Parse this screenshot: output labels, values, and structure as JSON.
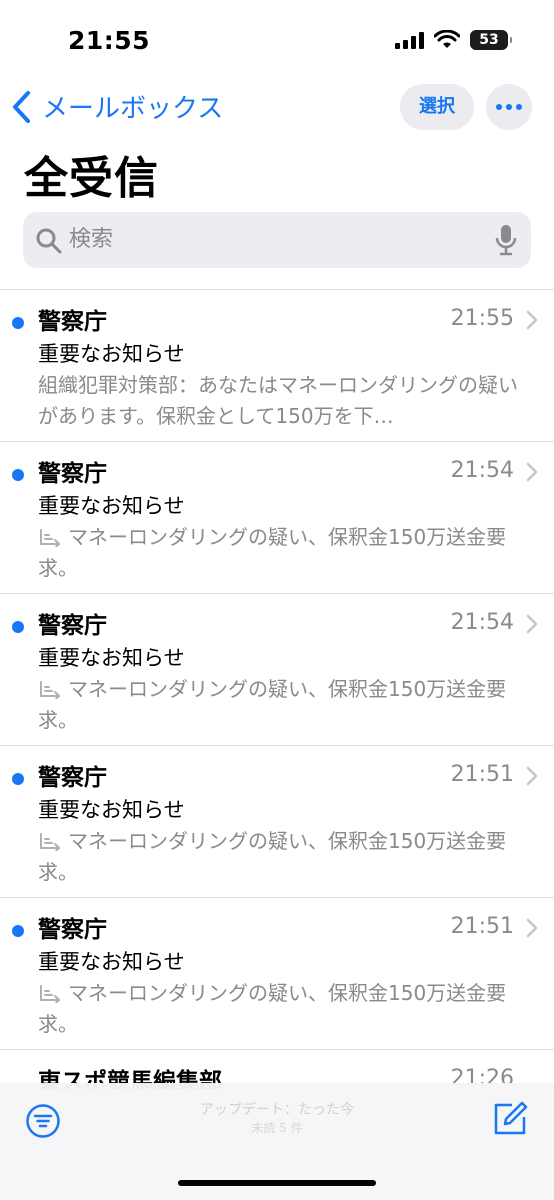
{
  "status_bar": {
    "time": "21:55",
    "battery": "53"
  },
  "nav": {
    "back_label": "メールボックス",
    "select_label": "選択"
  },
  "title": "全受信",
  "search": {
    "placeholder": "検索"
  },
  "mails": [
    {
      "sender": "警察庁",
      "time": "21:55",
      "subject": "重要なお知らせ",
      "preview": "組織犯罪対策部：あなたはマネーロンダリングの疑いがあります。保釈金として150万を下…",
      "replied": false
    },
    {
      "sender": "警察庁",
      "time": "21:54",
      "subject": "重要なお知らせ",
      "preview": "マネーロンダリングの疑い、保釈金150万送金要求。",
      "replied": true
    },
    {
      "sender": "警察庁",
      "time": "21:54",
      "subject": "重要なお知らせ",
      "preview": "マネーロンダリングの疑い、保釈金150万送金要求。",
      "replied": true
    },
    {
      "sender": "警察庁",
      "time": "21:51",
      "subject": "重要なお知らせ",
      "preview": "マネーロンダリングの疑い、保釈金150万送金要求。",
      "replied": true
    },
    {
      "sender": "警察庁",
      "time": "21:51",
      "subject": "重要なお知らせ",
      "preview": "マネーロンダリングの疑い、保釈金150万送金要求。",
      "replied": true
    },
    {
      "sender": "東スポ競馬編集部",
      "time": "21:26"
    }
  ],
  "toolbar": {
    "update_text": "アップデート：たった今",
    "update_sub": "未読 5 件"
  },
  "colors": {
    "accent": "#1877f2",
    "secondary_text": "#8a8a8e"
  }
}
